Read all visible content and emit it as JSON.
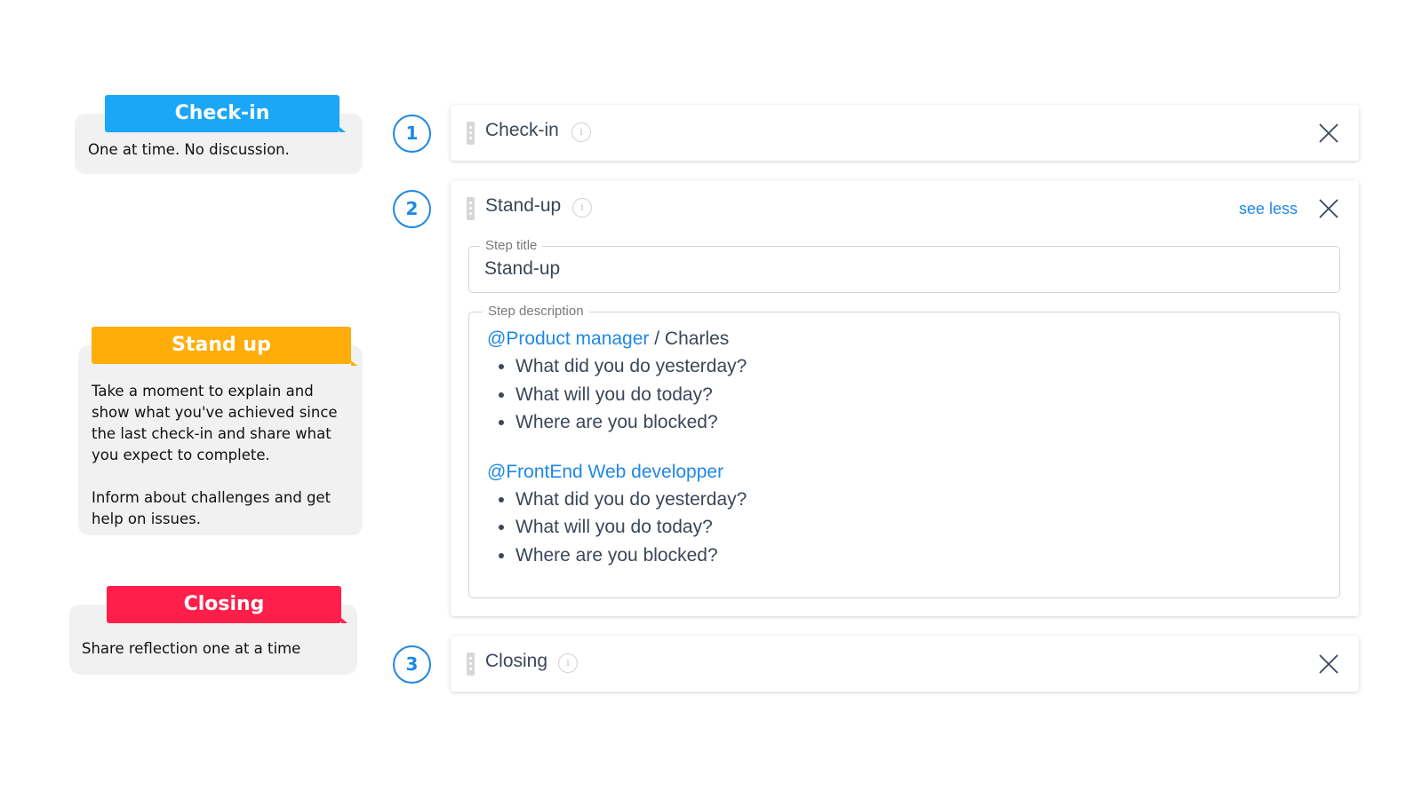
{
  "notes": [
    {
      "label": "Check-in",
      "color": "#1aa7f5",
      "text": "One at time. No discussion."
    },
    {
      "label": "Stand up",
      "color": "#ffad08",
      "text": "Take a moment to explain and\nshow what you've achieved since\nthe last check-in and share what\nyou expect to complete.\n\nInform about challenges and get\nhelp on issues."
    },
    {
      "label": "Closing",
      "color": "#ff1f4a",
      "text": "Share reflection one at a time"
    }
  ],
  "steps": [
    {
      "number": "1",
      "title": "Check-in"
    },
    {
      "number": "2",
      "title": "Stand-up",
      "see_less": "see less",
      "title_field": {
        "legend": "Step title",
        "value": "Stand-up"
      },
      "description_field": {
        "legend": "Step description",
        "blocks": [
          {
            "mention": "@Product manager",
            "suffix": " / Charles",
            "items": [
              "What did you do yesterday?",
              "What will you do today?",
              "Where are you blocked?"
            ]
          },
          {
            "mention": "@FrontEnd Web developper",
            "suffix": "",
            "items": [
              "What did you do yesterday?",
              "What will you do today?",
              "Where are you blocked?"
            ]
          }
        ]
      }
    },
    {
      "number": "3",
      "title": "Closing"
    }
  ],
  "icons": {
    "drag": "drag-handle-icon",
    "info": "info-icon",
    "close": "close-icon"
  },
  "colors": {
    "accent": "#1e88e5",
    "text": "#3b4658"
  }
}
